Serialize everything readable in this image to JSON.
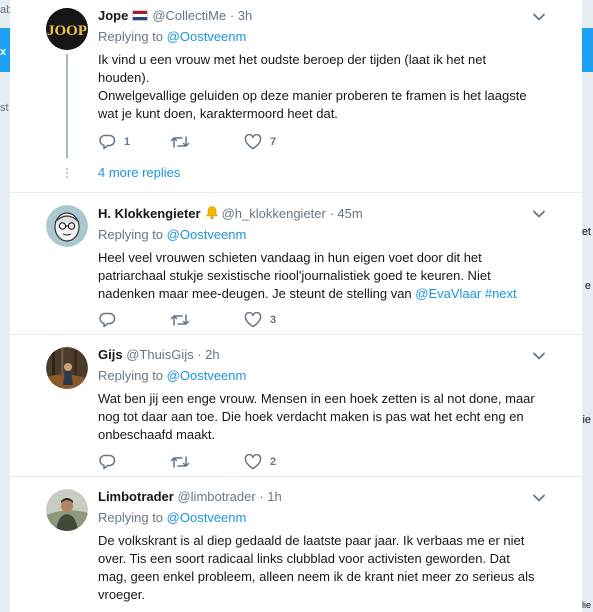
{
  "background": {
    "left_texts": [
      "ab",
      "x",
      "st"
    ],
    "right_texts": [
      "et",
      "e",
      "ie",
      "ilie"
    ]
  },
  "tweets": [
    {
      "display_name": "Jope",
      "handle": "@CollectiMe",
      "time": "3h",
      "avatar_text": "JOOP",
      "replying_prefix": "Replying to",
      "replying_to": "@Oostveenm",
      "body_lines": [
        "Ik vind u een vrouw met het oudste beroep der tijden (laat ik het net",
        "houden).",
        "Onwelgevallige geluiden op deze manier proberen te framen is het laagste",
        "wat je kunt doen, karaktermoord heet dat."
      ],
      "reply_count": "1",
      "retweet_count": "",
      "like_count": "7"
    },
    {
      "display_name": "H. Klokkengieter",
      "handle": "@h_klokkengieter",
      "time": "45m",
      "replying_prefix": "Replying to",
      "replying_to": "@Oostveenm",
      "body_lines": [
        "Heel veel vrouwen schieten vandaag in hun eigen voet door dit het",
        "patriarchaal stukje sexistische riool'journalistiek goed te keuren. Niet"
      ],
      "body_last_prefix": "nadenken maar mee-deugen. Je steunt de stelling van ",
      "body_mention": "@EvaVlaar",
      "body_hashtag": "#next",
      "reply_count": "",
      "retweet_count": "",
      "like_count": "3"
    },
    {
      "display_name": "Gijs",
      "handle": "@ThuisGijs",
      "time": "2h",
      "replying_prefix": "Replying to",
      "replying_to": "@Oostveenm",
      "body_lines": [
        "Wat ben jij een enge vrouw. Mensen in een hoek zetten is al not done, maar",
        "nog tot daar aan toe. Die hoek verdacht maken is pas wat het echt eng en",
        "onbeschaafd maakt."
      ],
      "reply_count": "",
      "retweet_count": "",
      "like_count": "2"
    },
    {
      "display_name": "Limbotrader",
      "handle": "@limbotrader",
      "time": "1h",
      "replying_prefix": "Replying to",
      "replying_to": "@Oostveenm",
      "body_lines": [
        "De volkskrant is al diep gedaald de laatste paar jaar. Ik verbaas me er niet",
        "over. Tis een soort radicaal links clubblad voor activisten geworden. Dat",
        "mag, geen enkel probleem, alleen neem ik de krant niet meer zo serieus als",
        "vroeger."
      ]
    }
  ],
  "more_replies": "4 more replies",
  "colors": {
    "link": "#1b95e0",
    "muted": "#657786",
    "text": "#14171a",
    "background": "#e6ecf0",
    "brand": "#1da1f2"
  },
  "icons": {
    "reply": "reply-icon",
    "retweet": "retweet-icon",
    "like": "heart-icon",
    "menu": "chevron-down-icon",
    "notification": "bell-icon",
    "flag": "netherlands-flag-icon"
  }
}
